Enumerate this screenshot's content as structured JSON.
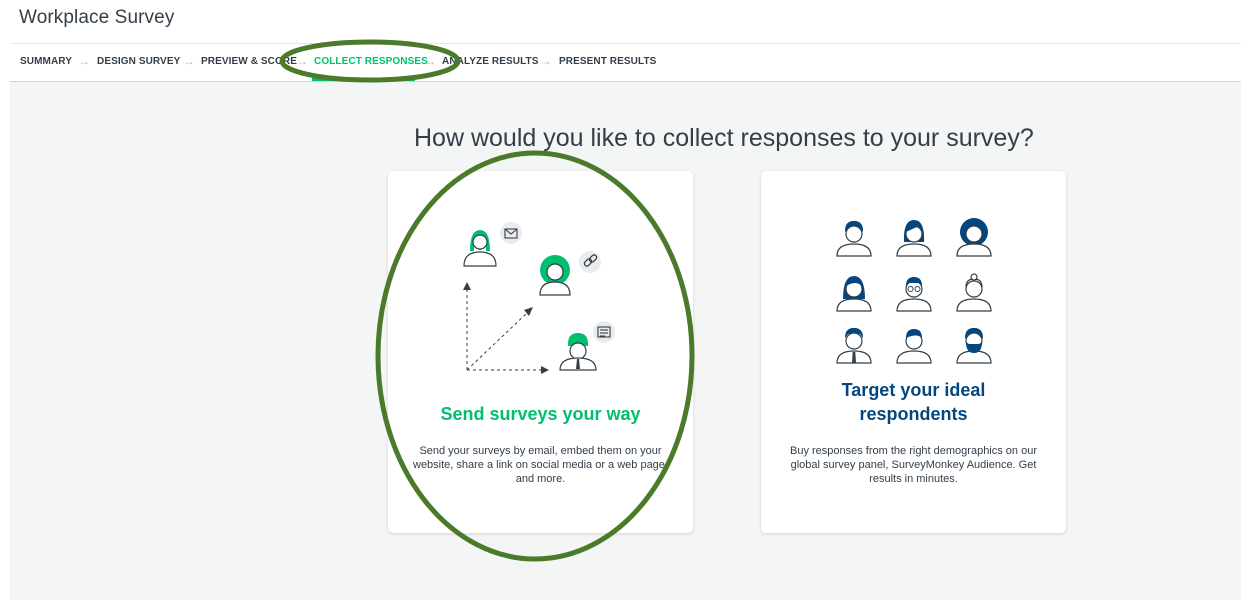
{
  "page": {
    "title": "Workplace Survey"
  },
  "steps": [
    {
      "label": "SUMMARY"
    },
    {
      "label": "DESIGN SURVEY"
    },
    {
      "label": "PREVIEW & SCORE"
    },
    {
      "label": "COLLECT RESPONSES",
      "active": true
    },
    {
      "label": "ANALYZE RESULTS"
    },
    {
      "label": "PRESENT RESULTS"
    }
  ],
  "main": {
    "question": "How would you like to collect responses to your survey?",
    "cards": [
      {
        "title": "Send surveys your way",
        "description": "Send your surveys by email, embed them on your website, share a link on social media or a web page, and more."
      },
      {
        "title": "Target your ideal respondents",
        "description": "Buy responses from the right demographics on our global survey panel, SurveyMonkey Audience. Get results in minutes."
      }
    ]
  },
  "colors": {
    "accent": "#00bf6f",
    "navy": "#05467e",
    "annotation": "#4a7a2a"
  },
  "icons": [
    "mail-icon",
    "link-icon",
    "document-icon",
    "person-icon"
  ]
}
